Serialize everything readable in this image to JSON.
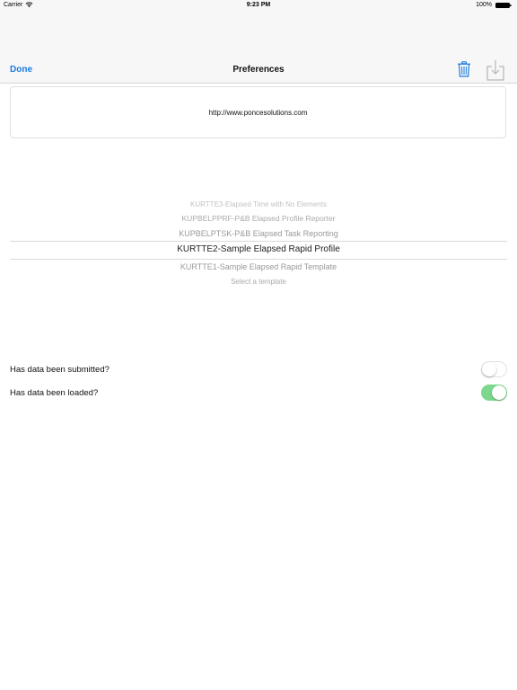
{
  "status_bar": {
    "carrier": "Carrier",
    "time": "9:23 PM",
    "battery": "100%"
  },
  "navbar": {
    "done_label": "Done",
    "title": "Preferences",
    "trash_icon": "trash-icon",
    "download_icon": "download-icon",
    "accent_color": "#1a7de0"
  },
  "url_field": {
    "value": "http://www.poncesolutions.com"
  },
  "template_picker": {
    "options": [
      "KURTTE3-Elapsed Time with No Elements",
      "KUPBELPPRF-P&B Elapsed Profile Reporter",
      "KUPBELPTSK-P&B Elapsed Task Reporting",
      "KURTTE2-Sample Elapsed Rapid Profile",
      "KURTTE1-Sample Elapsed Rapid Template",
      "Select a template"
    ],
    "selected": "KURTTE2-Sample Elapsed Rapid Profile"
  },
  "settings": {
    "submitted": {
      "label": "Has data been submitted?",
      "on": false
    },
    "loaded": {
      "label": "Has data been loaded?",
      "on": true
    },
    "toggle_on_color": "#7bd88d"
  }
}
